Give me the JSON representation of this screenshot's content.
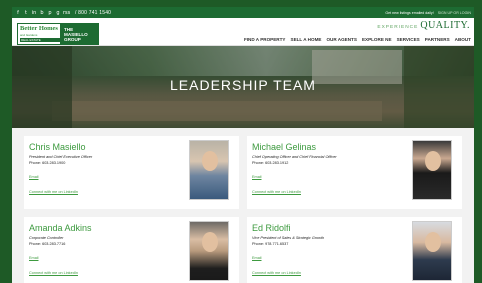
{
  "topbar": {
    "social_icons": [
      "f",
      "t",
      "in",
      "b",
      "p",
      "g",
      "rss"
    ],
    "social_names": [
      "facebook-icon",
      "twitter-icon",
      "linkedin-icon",
      "blog-icon",
      "pinterest-icon",
      "google-plus-icon",
      "rss-icon"
    ],
    "phone": "/ 800 741 1540",
    "listings_text": "Get new listings emailed daily!",
    "signup_text": "SIGN UP OR LOGIN"
  },
  "header": {
    "logo_line1": "Better Homes",
    "logo_line2": "and Gardens",
    "logo_line3": "REAL ESTATE",
    "logo_group": "THE MASIELLO GROUP",
    "tagline_small": "EXPERIENCE",
    "tagline_big": "QUALITY.",
    "nav": [
      "FIND A PROPERTY",
      "SELL A HOME",
      "OUR AGENTS",
      "EXPLORE NE",
      "SERVICES",
      "PARTNERS",
      "ABOUT"
    ]
  },
  "hero": {
    "title": "LEADERSHIP TEAM"
  },
  "team": [
    {
      "name": "Chris Masiello",
      "title": "President and Chief Executive Officer",
      "phone": "Phone: 603.283.1900",
      "email_label": "Email",
      "linkedin_label": "Connect with me on LinkedIn"
    },
    {
      "name": "Michael Gelinas",
      "title": "Chief Operating Officer and Chief Financial Officer",
      "phone": "Phone: 603.283.1912",
      "email_label": "Email",
      "linkedin_label": "Connect with me on LinkedIn"
    },
    {
      "name": "Amanda Adkins",
      "title": "Corporate Controller",
      "phone": "Phone: 603.283.7716",
      "email_label": "Email",
      "linkedin_label": "Connect with me on LinkedIn"
    },
    {
      "name": "Ed Ridolfi",
      "title": "Vice President of Sales & Strategic Growth",
      "phone": "Phone: 978.771.6537",
      "email_label": "Email",
      "linkedin_label": "Connect with me on LinkedIn"
    }
  ],
  "colors": {
    "brand_green": "#1d6b32",
    "link_green": "#3d9a3f"
  }
}
